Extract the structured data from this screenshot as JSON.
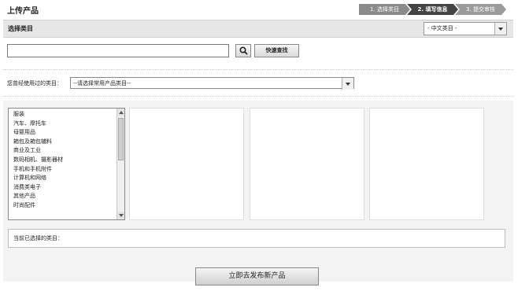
{
  "page": {
    "title": "上传产品"
  },
  "steps": [
    {
      "label": "1. 选择类目"
    },
    {
      "label": "2. 填写信息"
    },
    {
      "label": "3. 提交审核"
    }
  ],
  "category_bar": {
    "label": "选择类目",
    "language_select": "- 中文类目 -"
  },
  "search": {
    "value": "",
    "placeholder": "",
    "button_label": "快速查找"
  },
  "used_categories": {
    "label": "您曾经使用过的类目：",
    "select_value": "--请选择常用产品类目--"
  },
  "category_list": {
    "items": [
      "服装",
      "汽车、摩托车",
      "母婴用品",
      "箱包及箱包辅料",
      "商业及工业",
      "数码相机、摄影器材",
      "手机和手机附件",
      "计算机和网络",
      "消费类电子",
      "其他产品",
      "时尚配件"
    ]
  },
  "selected": {
    "label": "当前已选择的类目："
  },
  "publish_button": {
    "label": "立即去发布新产品"
  }
}
